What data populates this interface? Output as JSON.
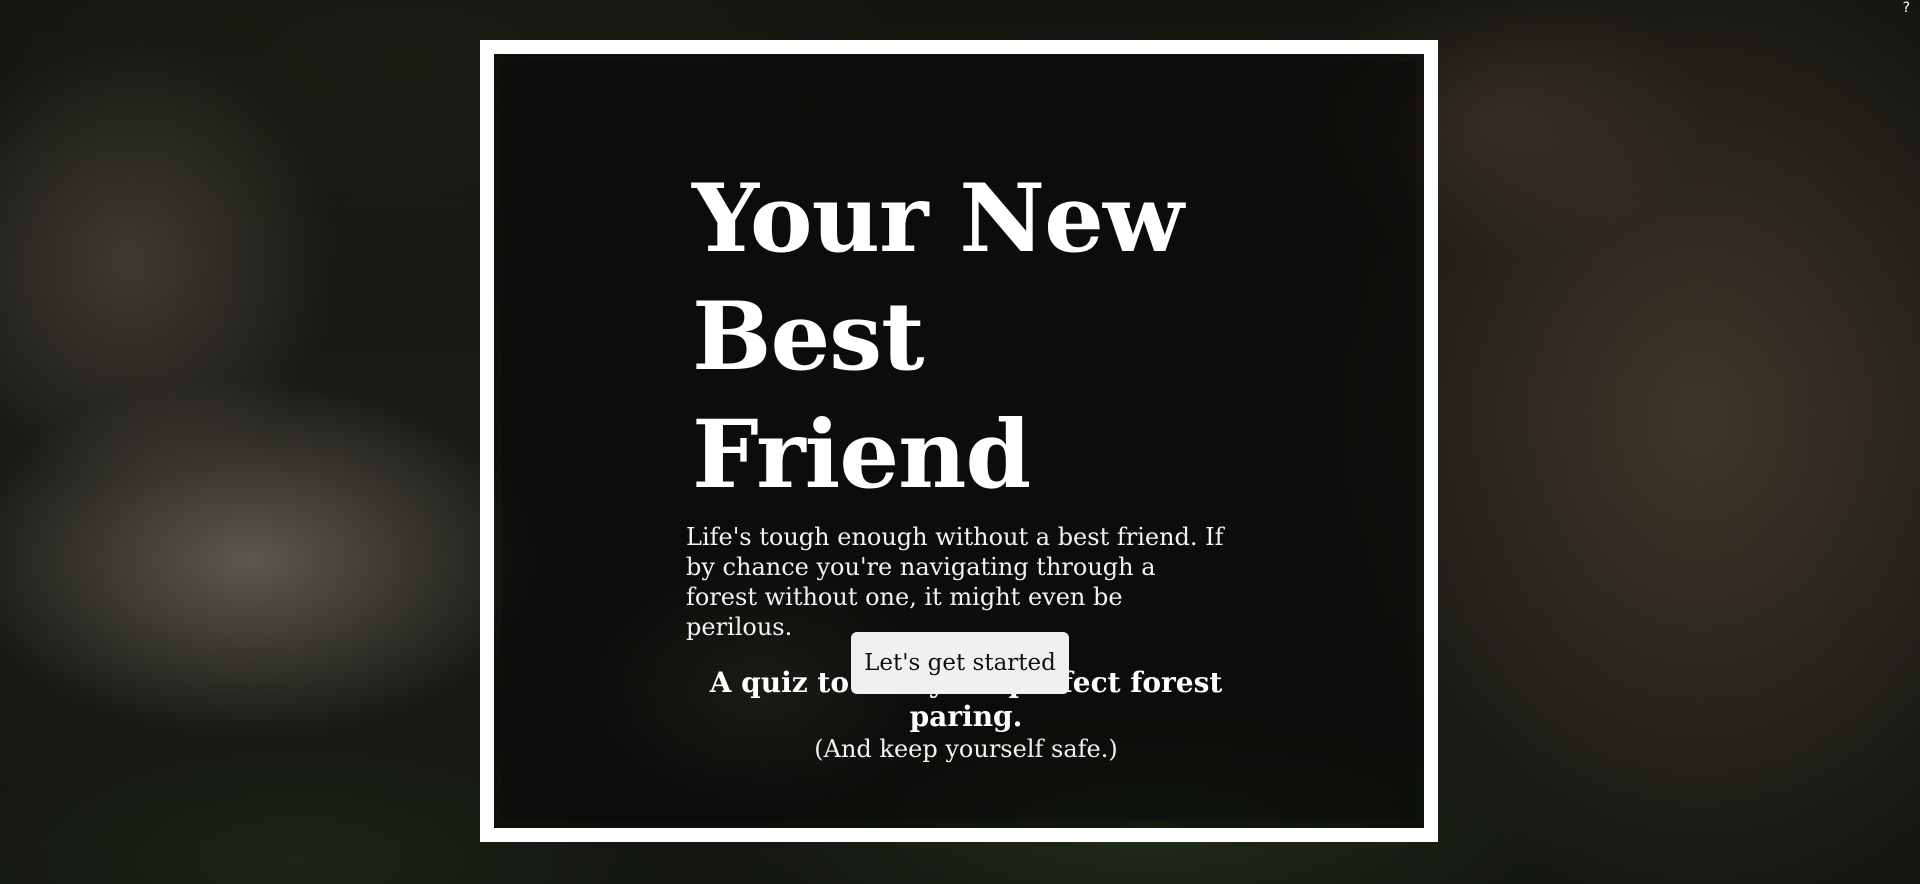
{
  "header": {
    "help_glyph": "?"
  },
  "hero": {
    "title_line1": "Your New",
    "title_line2": "Best Friend",
    "intro": "Life's tough enough without a best friend. If by chance you're navigating through a forest without one, it might even be perilous.",
    "tagline": "A quiz to find your perfect forest paring.",
    "sub_tagline": "(And keep yourself safe.)",
    "start_button_label": "Let's get started"
  },
  "theme": {
    "frame_color": "#ffffff",
    "text_color": "#ffffff",
    "button_bg": "#f0f0f0"
  }
}
